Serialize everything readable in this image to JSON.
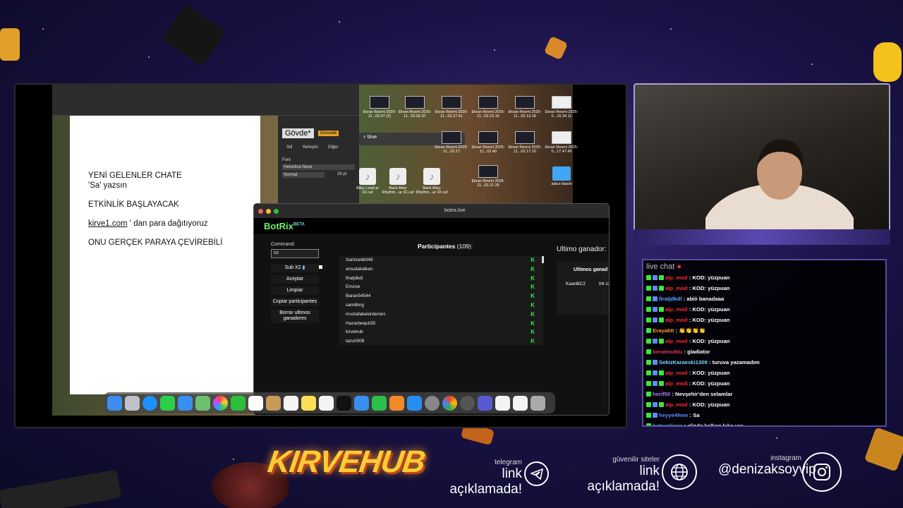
{
  "pages_doc": {
    "lines": [
      "YENİ GELENLER CHATE",
      "'Sa' yazsın",
      "ETKİNLİK BAŞLAYACAK",
      "kirve1.com",
      " ' dan para dağıtıyoruz",
      "ONU GERÇEK PARAYA ÇEVİREBİLİ"
    ],
    "format": {
      "style": "Gövde*",
      "btn": "Güncelle",
      "tabs": [
        "Stil",
        "Yerleşim",
        "Diğer"
      ],
      "font_label": "Font",
      "font": "Helvetica Neue",
      "weight": "Normal",
      "size": "26 pt"
    }
  },
  "finder": {
    "search": "blue",
    "files_top": [
      {
        "name": "Ekran Resmi 2025-11...02.47 (2)"
      },
      {
        "name": "Ekran Resmi 2025-11...02.50.37"
      },
      {
        "name": "Ekran Resmi 2025-11...02.27.41"
      },
      {
        "name": "Ekran Resmi 2025-11...02.23.16"
      },
      {
        "name": "Ekran Resmi 2025-11...02.13.18"
      },
      {
        "name": "Ekran Resmi 2025-0...15.34.11"
      }
    ],
    "files_mid": [
      {
        "name": "Ekran Resmi 2025-11...02.17"
      },
      {
        "name": "Ekran Resmi 2025-11...02.40"
      },
      {
        "name": "Ekran Resmi 2025-11...02.17.10"
      },
      {
        "name": "Ekran Resmi 2025-0...17.47.40"
      }
    ],
    "files_audio": [
      {
        "name": "Alley Load ar 02.caf"
      },
      {
        "name": "Back Alley Rhythm...ar 01.caf"
      },
      {
        "name": "Back Alley Rhythm...ar 02.caf"
      }
    ],
    "file_shot": "Ekran Resmi 2025-11...02.21.26",
    "folder": "adsız klasör"
  },
  "browser": {
    "url": "botrix.live",
    "brand": "BotRix",
    "beta": "BETA",
    "command_label": "Command:",
    "command_value": "ss",
    "sub_label": "Sub X2",
    "buttons": [
      "Aceptar",
      "Limpiar",
      "Copiar participantes",
      "Borrar ultimos ganadores"
    ],
    "participants_title": "Participantes",
    "participants_count": "(109):",
    "participants": [
      "Samicelik049",
      "amudakalkan",
      "firatjdkdl",
      "Emzoe",
      "Baran54544",
      "samilbng",
      "mustafabekirdemirc",
      "Hazarbequit35",
      "kirvehub",
      "lazuri008"
    ],
    "last_winner_label": "Ultimo ganador:",
    "winners_title": "Ultimos ganad",
    "winner_name": "KaanBC2",
    "winner_date": "04-12"
  },
  "chat": {
    "title": "live chat",
    "messages": [
      {
        "user": "alp_mod",
        "text": ": KOD: yüzpuan",
        "color": "#ff2a2a"
      },
      {
        "user": "alp_mod",
        "text": ": KOD: yüzpuan",
        "color": "#ff2a2a"
      },
      {
        "user": "firatjdkdl",
        "text": ": abiii banadaaa",
        "color": "#5aa9ff"
      },
      {
        "user": "alp_mod",
        "text": ": KOD: yüzpuan",
        "color": "#ff2a2a"
      },
      {
        "user": "alp_mod",
        "text": ": KOD: yüzpuan",
        "color": "#ff2a2a"
      },
      {
        "user": "Erayaktt",
        "text": ": 👏👏👏👏",
        "color": "#ff9a2a"
      },
      {
        "user": "alp_mod",
        "text": ": KOD: yüzpuan",
        "color": "#ff2a2a"
      },
      {
        "user": "beratmuttlu",
        "text": ": gladiator",
        "color": "#d8355a"
      },
      {
        "user": "SekizKaraeski1309",
        "text": ": turuva yazamadım",
        "color": "#7ad7ff"
      },
      {
        "user": "alp_mod",
        "text": ": KOD: yüzpuan",
        "color": "#ff2a2a"
      },
      {
        "user": "alp_mod",
        "text": ": KOD: yüzpuan",
        "color": "#ff2a2a"
      },
      {
        "user": "herif50",
        "text": ": Nevşehir'den selamlar",
        "color": "#b07aff"
      },
      {
        "user": "alp_mod",
        "text": ": KOD: yüzpuan",
        "color": "#ff2a2a"
      },
      {
        "user": "heyye4feee",
        "text": ": Sa",
        "color": "#5a8cff"
      },
      {
        "user": "kutayalisnn",
        "text": ": elinde kalkan kılıc var",
        "color": "#3fd6b0"
      }
    ]
  },
  "footer": {
    "logo": "KIRVEHUB",
    "telegram_small": "telegram",
    "telegram_big": "link açıklamada!",
    "sites_small": "güvenilir siteler",
    "sites_big": "link açıklamada!",
    "instagram_small": "instagram",
    "instagram_big": "@denizaksoyvip"
  },
  "colors": {
    "kick_green": "#3be83b",
    "accent_purple": "#5a4a9a",
    "logo_gold": "#ffcc33"
  }
}
